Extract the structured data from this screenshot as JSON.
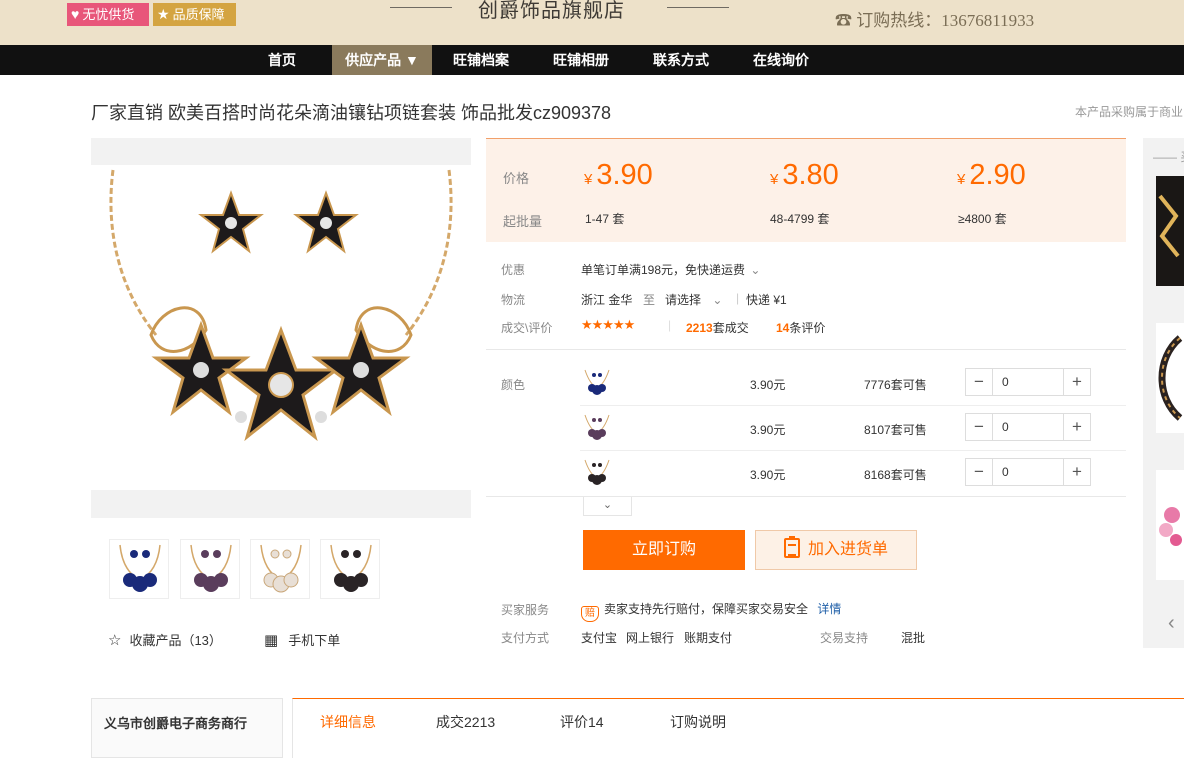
{
  "header": {
    "badges": [
      "无忧供货",
      "品质保障"
    ],
    "store_name": "创爵饰品旗舰店",
    "hotline": "订购热线：13676811933"
  },
  "nav": {
    "items": [
      "首页",
      "供应产品 ▼",
      "旺铺档案",
      "旺铺相册",
      "联系方式",
      "在线询价"
    ],
    "active_index": 1
  },
  "product": {
    "title": "厂家直销 欧美百搭时尚花朵滴油镶钻项链套装 饰品批发cz909378",
    "top_right_note": "本产品采购属于商业"
  },
  "price_tiers": {
    "price_label": "价格",
    "moq_label": "起批量",
    "currency": "¥",
    "tiers": [
      {
        "price": "3.90",
        "range": "1-47 套"
      },
      {
        "price": "3.80",
        "range": "48-4799 套"
      },
      {
        "price": "2.90",
        "range": "≥4800 套"
      }
    ]
  },
  "info": {
    "discount_label": "优惠",
    "discount_text": "单笔订单满198元，免快递运费",
    "logistics_label": "物流",
    "origin": "浙江 金华",
    "to": "至",
    "destination": "请选择",
    "express": "快递 ¥1",
    "rating_label": "成交\\评价",
    "stars": "★★★★★",
    "deals_count": "2213",
    "deals_suffix": "套成交",
    "reviews_count": "14",
    "reviews_suffix": "条评价"
  },
  "variants": {
    "label": "颜色",
    "items": [
      {
        "price": "3.90元",
        "stock": "7776套可售",
        "qty": "0",
        "color": "#1a2a7a"
      },
      {
        "price": "3.90元",
        "stock": "8107套可售",
        "qty": "0",
        "color": "#5a3d5c"
      },
      {
        "price": "3.90元",
        "stock": "8168套可售",
        "qty": "0",
        "color": "#2a2426"
      }
    ],
    "expand_icon": "chevron-down"
  },
  "actions": {
    "buy_label": "立即订购",
    "cart_label": "加入进货单"
  },
  "services": {
    "buyer_label": "买家服务",
    "buyer_text": "卖家支持先行赔付，保障买家交易安全",
    "details_link": "详情",
    "payment_label": "支付方式",
    "payment_methods": [
      "支付宝",
      "网上银行",
      "账期支付"
    ],
    "trade_label": "交易支持",
    "trade_value": "混批"
  },
  "gallery": {
    "thumb_colors": [
      "#1a2a7a",
      "#5a3d5c",
      "#e8dfd6",
      "#2a2426"
    ],
    "favorite_label": "收藏产品（13）",
    "mobile_label": "手机下单"
  },
  "sidebar": {
    "heading": "买"
  },
  "bottom": {
    "shop_name": "义乌市创爵电子商务商行",
    "tabs": [
      "详细信息",
      "成交2213",
      "评价14",
      "订购说明"
    ],
    "active_tab": 0
  },
  "colors": {
    "accent": "#ff6a00",
    "header_bg": "#ede1c9",
    "nav_bg": "#111111",
    "nav_active": "#8a7a5c"
  }
}
